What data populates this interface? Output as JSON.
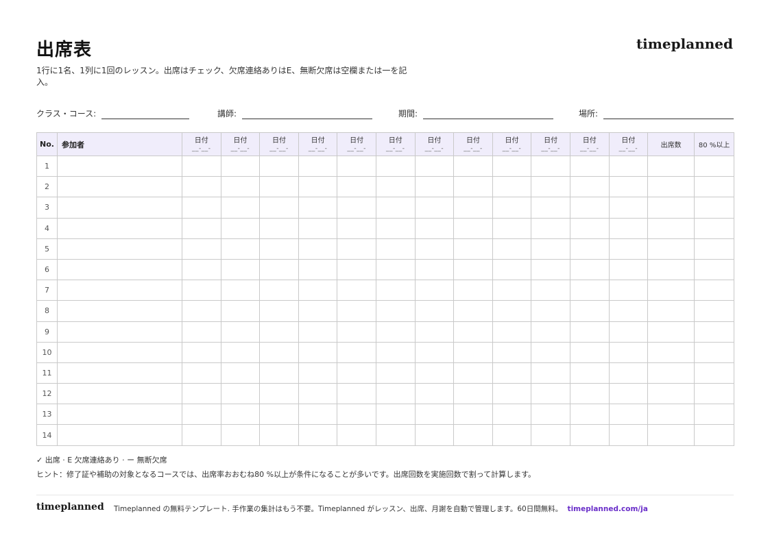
{
  "header": {
    "title": "出席表",
    "brand": "timeplanned",
    "subtitle": "1行に1名、1列に1回のレッスン。出席はチェック、欠席連絡ありはE、無断欠席は空欄または一を記入。"
  },
  "fields": {
    "class_label": "クラス・コース:",
    "teacher_label": "講師:",
    "period_label": "期間:",
    "place_label": "場所:"
  },
  "table": {
    "no_header": "No.",
    "name_header": "参加者",
    "date_header": "日付",
    "date_placeholder": "__-__-",
    "attendance_count_header": "出席数",
    "threshold_header": "80 %以上",
    "date_columns": 12,
    "row_numbers": [
      "1",
      "2",
      "3",
      "4",
      "5",
      "6",
      "7",
      "8",
      "9",
      "10",
      "11",
      "12",
      "13",
      "14"
    ]
  },
  "legend": {
    "text": "✓ 出席 · E 欠席連絡あり · ー 無断欠席"
  },
  "hint": {
    "text": "ヒント：修了証や補助の対象となるコースでは、出席率おおむね80 %以上が条件になることが多いです。出席回数を実施回数で割って計算します。"
  },
  "footer": {
    "brand": "timeplanned",
    "text": "Timeplanned の無料テンプレート. 手作業の集計はもう不要。Timeplanned がレッスン、出席、月謝を自動で管理します。60日間無料。",
    "link": "timeplanned.com/ja"
  }
}
